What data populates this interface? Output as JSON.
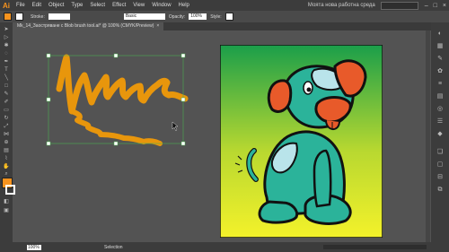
{
  "app": {
    "logo": "Ai"
  },
  "menu": [
    "File",
    "Edit",
    "Object",
    "Type",
    "Select",
    "Effect",
    "View",
    "Window",
    "Help"
  ],
  "workspace": {
    "label": "Моята нова работна среда",
    "search_placeholder": ""
  },
  "control_bar": {
    "fill_color": "#f7931e",
    "stroke_color": "#ffffff",
    "stroke_label": "Stroke:",
    "brush_label": "Basic",
    "opacity_label": "Opacity:",
    "opacity_value": "100%",
    "style_label": "Style:"
  },
  "document_tab": {
    "title": "Mk_14_Заостряване с Blob brush tool.ai* @ 100% (CMYK/Preview)",
    "close": "×"
  },
  "status": {
    "zoom": "100%",
    "tool": "Selection"
  },
  "colors": {
    "accent": "#f7931e",
    "ui_dark": "#3c3c3c",
    "pasteboard": "#535353",
    "selection": "#4caf50"
  },
  "icons": [
    "selection-tool-icon",
    "direct-selection-tool-icon",
    "magic-wand-icon",
    "lasso-icon",
    "pen-tool-icon",
    "type-tool-icon",
    "line-tool-icon",
    "rectangle-tool-icon",
    "paintbrush-icon",
    "pencil-icon",
    "blob-brush-icon",
    "eraser-icon",
    "rotate-icon",
    "scale-icon",
    "width-tool-icon",
    "free-transform-icon",
    "shape-builder-icon",
    "perspective-grid-icon",
    "mesh-icon",
    "gradient-icon",
    "eyedropper-icon",
    "blend-icon",
    "symbol-sprayer-icon",
    "graph-icon",
    "artboard-tool-icon",
    "slice-icon",
    "hand-icon",
    "zoom-icon"
  ]
}
